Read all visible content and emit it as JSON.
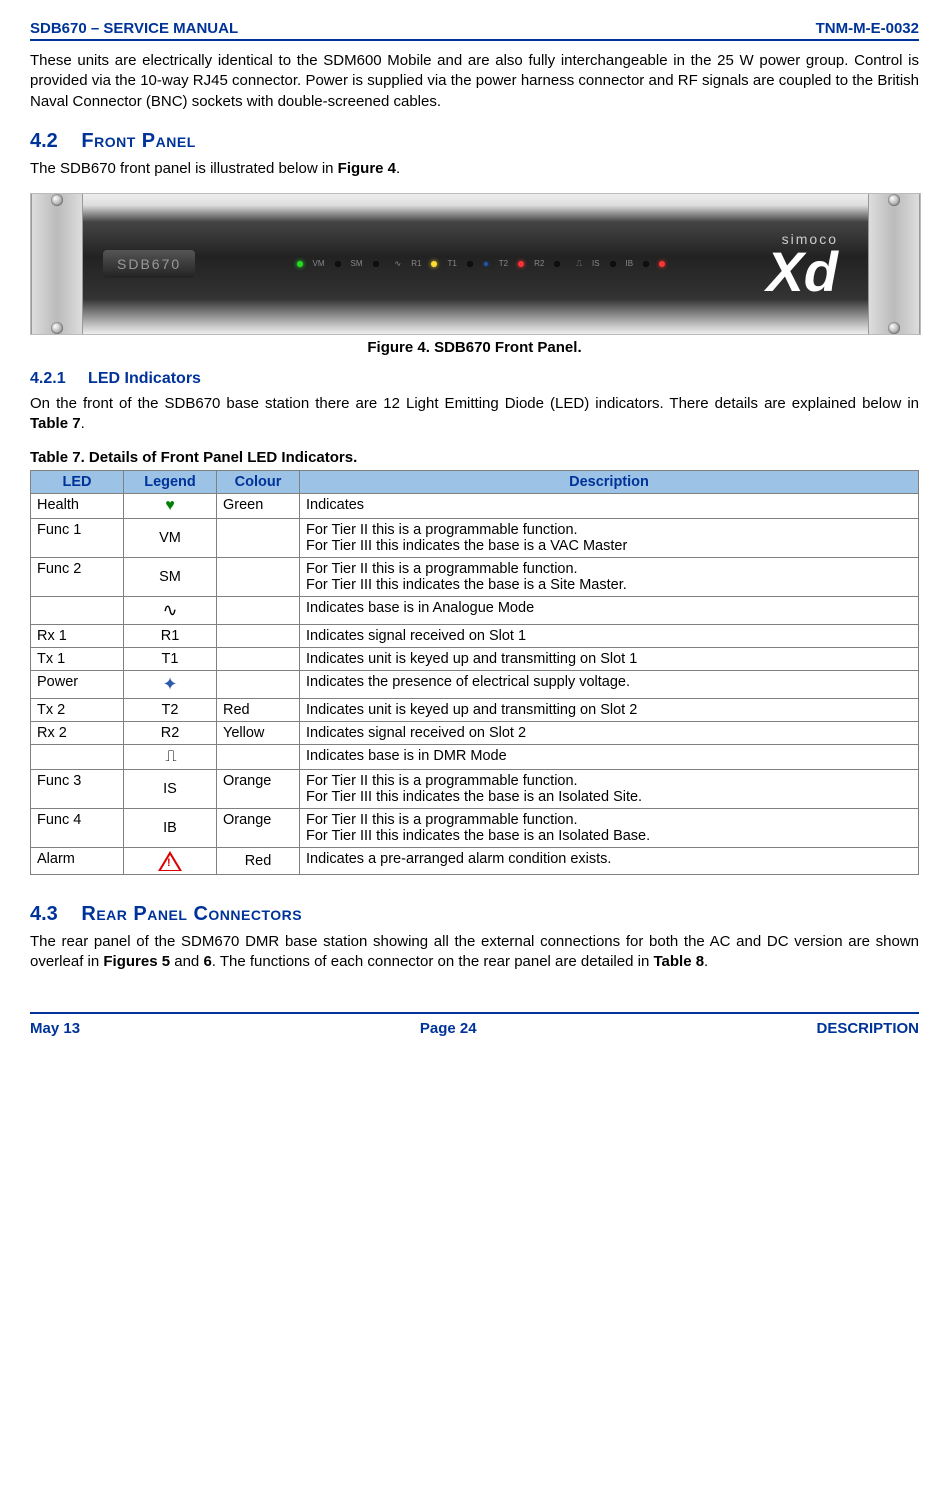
{
  "header": {
    "left": "SDB670 – SERVICE MANUAL",
    "right": "TNM-M-E-0032"
  },
  "intro_para": "These units are electrically identical to the SDM600 Mobile and are also fully interchangeable in the 25 W power group.  Control is provided via the 10-way RJ45 connector.  Power is supplied via the power harness connector and RF signals are coupled to the British Naval Connector (BNC) sockets with double-screened cables.",
  "sec42": {
    "num": "4.2",
    "title": "Front Panel"
  },
  "sec42_text_a": "The SDB670 front panel is illustrated below in ",
  "sec42_text_b": "Figure 4",
  "sec42_text_c": ".",
  "panel": {
    "model": "SDB670",
    "logo_top": "simoco",
    "logo_main": "Xd",
    "led_labels": [
      "VM",
      "SM",
      "R1",
      "T1",
      "T2",
      "R2",
      "IS",
      "IB"
    ]
  },
  "fig4_caption": "Figure 4.  SDB670 Front Panel.",
  "sec421": {
    "num": "4.2.1",
    "title": "LED Indicators"
  },
  "sec421_text_a": "On the front of the SDB670 base station there are 12 Light Emitting Diode (LED) indicators.  There details are explained below in ",
  "sec421_text_b": "Table 7",
  "sec421_text_c": ".",
  "table7_caption": "Table 7.  Details of Front Panel LED Indicators.",
  "table7_headers": {
    "led": "LED",
    "legend": "Legend",
    "colour": "Colour",
    "description": "Description"
  },
  "table7_rows": [
    {
      "led": "Health",
      "legend_type": "heart",
      "legend": "♥",
      "colour": "Green",
      "desc": "Indicates"
    },
    {
      "led": "Func 1",
      "legend_type": "text",
      "legend": "VM",
      "colour": "",
      "desc": "For Tier II this is a programmable function.\nFor Tier III this indicates the base is a VAC Master"
    },
    {
      "led": "Func 2",
      "legend_type": "text",
      "legend": "SM",
      "colour": "",
      "desc": "For Tier II this is a programmable function.\nFor Tier III this indicates the base is a Site Master."
    },
    {
      "led": "",
      "legend_type": "wave",
      "legend": "∿",
      "colour": "",
      "desc": "Indicates base is in Analogue Mode"
    },
    {
      "led": "Rx 1",
      "legend_type": "text",
      "legend": "R1",
      "colour": "",
      "desc": "Indicates signal received on Slot 1"
    },
    {
      "led": "Tx 1",
      "legend_type": "text",
      "legend": "T1",
      "colour": "",
      "desc": "Indicates unit is keyed up and transmitting on Slot 1"
    },
    {
      "led": "Power",
      "legend_type": "power",
      "legend": "✦",
      "colour": "",
      "desc": "Indicates the presence of electrical supply voltage."
    },
    {
      "led": "Tx 2",
      "legend_type": "text",
      "legend": "T2",
      "colour": "Red",
      "desc": "Indicates unit is keyed up and transmitting on Slot 2"
    },
    {
      "led": "Rx 2",
      "legend_type": "text",
      "legend": "R2",
      "colour": "Yellow",
      "desc": "Indicates signal received on Slot 2"
    },
    {
      "led": "",
      "legend_type": "square",
      "legend": "⎍",
      "colour": "",
      "desc": "Indicates base is in DMR Mode"
    },
    {
      "led": "Func 3",
      "legend_type": "text",
      "legend": "IS",
      "colour": "Orange",
      "desc": "For Tier II this is a programmable function.\nFor Tier III this indicates the base is an Isolated Site."
    },
    {
      "led": "Func 4",
      "legend_type": "text",
      "legend": "IB",
      "colour": "Orange",
      "desc": "For Tier II this is a programmable function.\nFor Tier III this indicates the base is an Isolated Base."
    },
    {
      "led": "Alarm",
      "legend_type": "alarm",
      "legend": "!",
      "colour": "Red",
      "desc": "Indicates a pre-arranged alarm condition exists."
    }
  ],
  "sec43": {
    "num": "4.3",
    "title": "Rear Panel Connectors"
  },
  "sec43_text_a": "The rear panel of the SDM670 DMR base station showing all the external connections for both the AC and DC version are shown overleaf in ",
  "sec43_text_b": "Figures 5 ",
  "sec43_text_c": "and ",
  "sec43_text_d": "6",
  "sec43_text_e": ".  The functions of each connector on the rear panel are detailed in ",
  "sec43_text_f": "Table 8",
  "sec43_text_g": ".",
  "footer": {
    "left": "May 13",
    "center": "Page 24",
    "right": "DESCRIPTION"
  }
}
